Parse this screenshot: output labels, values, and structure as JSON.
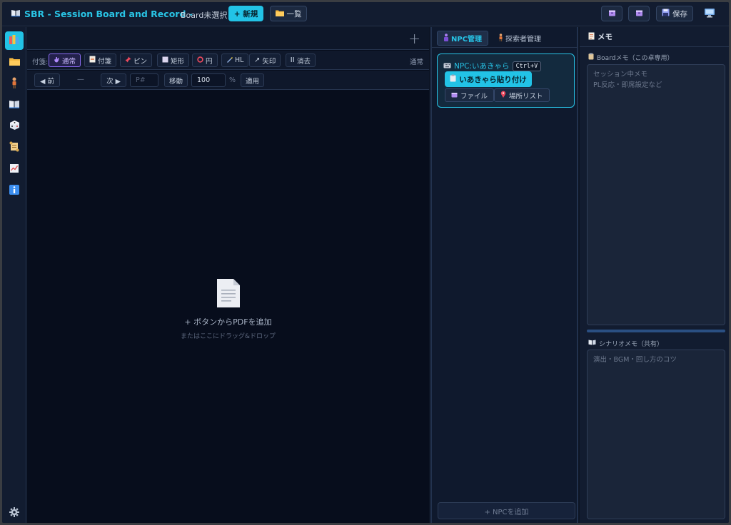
{
  "header": {
    "title": "SBR - Session Board and Record -",
    "board_status": "Board未選択",
    "new_label": "+ 新規",
    "list_label": "一覧",
    "save_label": "保存"
  },
  "icons": {
    "title": "book-icon",
    "list": "folder-icon",
    "export1": "package-icon",
    "export2": "package-icon",
    "save": "floppy-icon",
    "monitor": "monitor-icon"
  },
  "sidebar": {
    "items": [
      {
        "icon": "books-icon",
        "active": true
      },
      {
        "icon": "folder-icon"
      },
      {
        "icon": "person-icon"
      },
      {
        "icon": "open-book-icon"
      },
      {
        "icon": "dice-icon"
      },
      {
        "icon": "scroll-icon"
      },
      {
        "icon": "chart-icon"
      },
      {
        "icon": "info-icon"
      }
    ],
    "settings_icon": "gear-icon"
  },
  "toolbar": {
    "label": "付箋:",
    "tools": [
      {
        "label": "通常",
        "icon": "hand-icon",
        "active": true
      },
      {
        "label": "付箋",
        "icon": "memo-icon"
      },
      {
        "label": "ピン",
        "icon": "pin-icon"
      },
      {
        "label": "矩形",
        "icon": "square-icon"
      },
      {
        "label": "円",
        "icon": "circle-icon"
      },
      {
        "label": "HL",
        "icon": "highlighter-icon"
      },
      {
        "label": "矢印",
        "icon": "arrow-icon"
      },
      {
        "label": "消去",
        "icon": "eraser-icon"
      }
    ],
    "mode": "通常"
  },
  "pager": {
    "prev": "◀ 前",
    "dash": "—",
    "next": "次 ▶",
    "page_placeholder": "P#",
    "move": "移動",
    "zoom": "100",
    "pct": "%",
    "apply": "適用"
  },
  "dropzone": {
    "message": "+ ボタンからPDFを追加",
    "hint": "またはここにドラッグ&ドロップ"
  },
  "npc_panel": {
    "tabs": [
      {
        "label": "NPC管理",
        "active": true
      },
      {
        "label": "探索者管理"
      }
    ],
    "card_title": "NPC:いあきゃら",
    "shortcut": "Ctrl+V",
    "paste_label": "いあきゃら貼り付け",
    "file_label": "ファイル",
    "place_label": "場所リスト",
    "add_label": "+ NPCを追加"
  },
  "memo": {
    "title": "メモ",
    "board_label": "Boardメモ（この卓専用）",
    "board_placeholder": "セッション中メモ\nPL反応・即席設定など",
    "scenario_label": "シナリオメモ（共有）",
    "scenario_placeholder": "演出・BGM・回し方のコツ"
  },
  "colors": {
    "accent": "#22c3e6",
    "background": "#0d1525",
    "active_tool": "#8b6cf5"
  }
}
